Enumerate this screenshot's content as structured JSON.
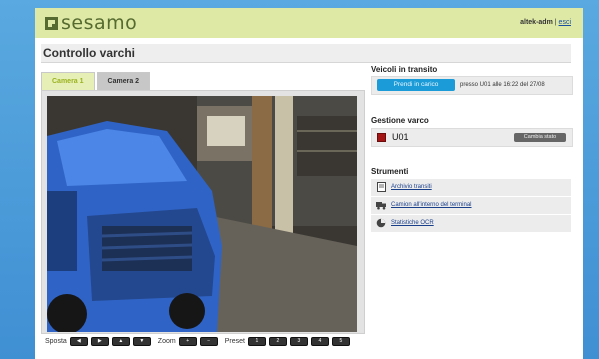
{
  "header": {
    "logo_text": "sesamo",
    "user": "altek-adm",
    "separator": "|",
    "logout_label": "esci"
  },
  "page_title": "Controllo varchi",
  "tabs": [
    {
      "label": "Camera 1",
      "active": true
    },
    {
      "label": "Camera 2",
      "active": false
    }
  ],
  "camera_controls": {
    "move_label": "Sposta",
    "move_buttons": [
      "left-arrow-icon",
      "right-arrow-icon",
      "up-arrow-icon",
      "down-arrow-icon"
    ],
    "zoom_label": "Zoom",
    "zoom_buttons": [
      "zoom-in-icon",
      "zoom-out-icon"
    ],
    "preset_label": "Preset",
    "presets": [
      "1",
      "2",
      "3",
      "4",
      "5"
    ]
  },
  "transit": {
    "title": "Veicoli in transito",
    "take_button": "Prendi in carico",
    "info": "presso U01 alle 16:22 del 27/08"
  },
  "gate": {
    "title": "Gestione varco",
    "name": "U01",
    "status_color": "#a31414",
    "change_state_button": "Cambia stato"
  },
  "tools": {
    "title": "Strumenti",
    "items": [
      {
        "label": "Archivio transiti",
        "icon": "archive-icon"
      },
      {
        "label": "Camion all'interno del terminal",
        "icon": "truck-icon"
      },
      {
        "label": "Statistiche OCR",
        "icon": "pie-chart-icon"
      }
    ]
  },
  "colors": {
    "accent_green": "#556b2f",
    "header_bg": "#dfe9a6",
    "button_blue": "#1b9bd8",
    "page_bg_blue": "#3f8fd3"
  }
}
